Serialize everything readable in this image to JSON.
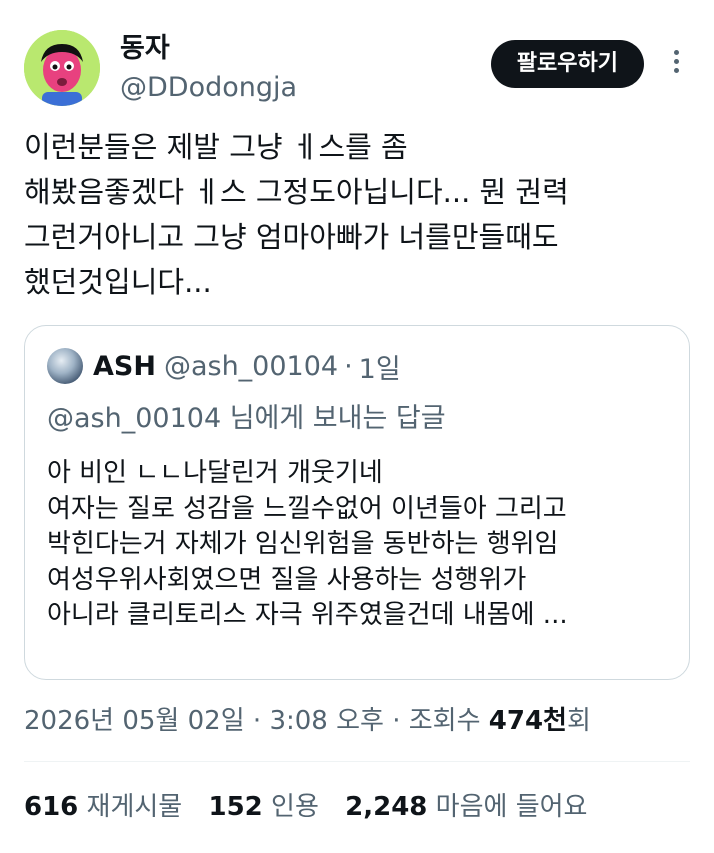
{
  "author": {
    "display_name": "동자",
    "handle": "@DDodongja",
    "avatar": "cartoon-face-avatar"
  },
  "follow_button": {
    "label": "팔로우하기"
  },
  "more_icon": "more-vertical-icon",
  "tweet": {
    "text": "이런분들은 제발 그냥 ㅔ스를 좀\n해봤음좋겠다 ㅔ스 그정도아닙니다... 뭔 권력\n그런거아니고 그냥 엄마아빠가 너를만들때도\n했던것입니다..."
  },
  "quote": {
    "name": "ASH",
    "handle": "@ash_00104",
    "separator": "·",
    "time": "1일",
    "reply_to": "@ash_00104 님에게 보내는 답글",
    "body": "아 비인 ㄴㄴ나달린거 개웃기네\n여자는 질로 성감을 느낄수없어 이년들아 그리고\n박힌다는거 자체가 임신위험을 동반하는 행위임\n여성우위사회였으면 질을 사용하는 성행위가\n아니라 클리토리스 자극 위주였을건데 내몸에 ..."
  },
  "meta": {
    "date": "2026년 05월 02일",
    "sep1": " · ",
    "time": "3:08 오후",
    "sep2": " · ",
    "views_label": "조회수 ",
    "views_value": "474천",
    "views_suffix": "회"
  },
  "stats": {
    "reposts": {
      "value": "616",
      "label": "재게시물"
    },
    "quotes": {
      "value": "152",
      "label": "인용"
    },
    "likes": {
      "value": "2,248",
      "label": "마음에 들어요"
    }
  },
  "colors": {
    "text": "#0f1419",
    "secondary": "#536471",
    "avatar_bg": "#b9e86f",
    "border": "#cfd9de"
  }
}
